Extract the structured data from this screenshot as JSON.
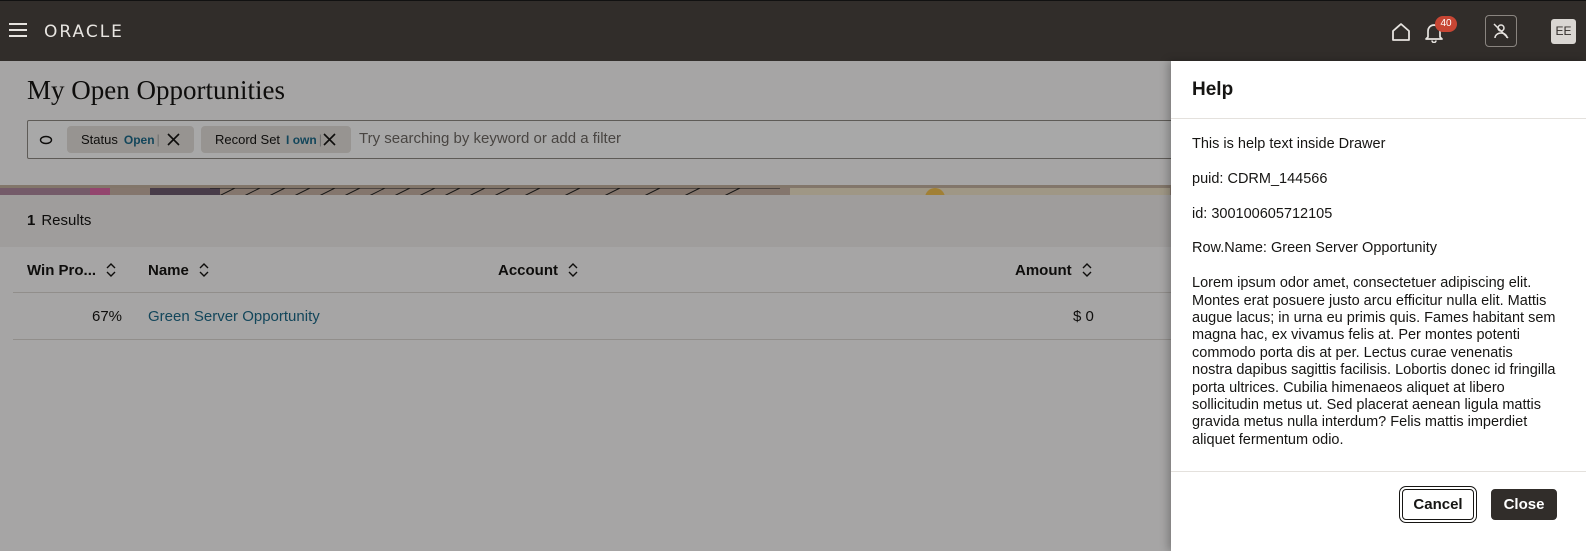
{
  "header": {
    "logo_text": "ORACLE",
    "notification_count": "40",
    "avatar_initials": "EE"
  },
  "page": {
    "title": "My Open Opportunities"
  },
  "search": {
    "chips": [
      {
        "label": "Status",
        "value": "Open"
      },
      {
        "label": "Record Set",
        "value": "I own"
      }
    ],
    "placeholder": "Try searching by keyword or add a filter"
  },
  "results": {
    "count": "1",
    "label": "Results"
  },
  "table": {
    "columns": [
      "Win Pro...",
      "Name",
      "Account",
      "Amount"
    ],
    "rows": [
      {
        "win_probability": "67%",
        "name": "Green Server Opportunity",
        "account": "",
        "amount": "$ 0"
      }
    ]
  },
  "drawer": {
    "title": "Help",
    "lines": [
      "This is help text inside Drawer",
      "puid: CDRM_144566",
      "id: 300100605712105",
      "Row.Name: Green Server Opportunity"
    ],
    "paragraph": "Lorem ipsum odor amet, consectetuer adipiscing elit. Montes erat posuere justo arcu efficitur nulla elit. Mattis augue lacus; in urna eu primis quis. Fames habitant sem magna hac, ex vivamus felis at. Per montes potenti commodo porta dis at per. Lectus curae venenatis nostra dapibus sagittis facilisis. Lobortis donec id fringilla porta ultrices. Cubilia himenaeos aliquet at libero sollicitudin metus ut. Sed placerat aenean ligula mattis gravida metus nulla interdum? Felis mattis imperdiet aliquet fermentum odio.",
    "cancel_label": "Cancel",
    "close_label": "Close"
  }
}
